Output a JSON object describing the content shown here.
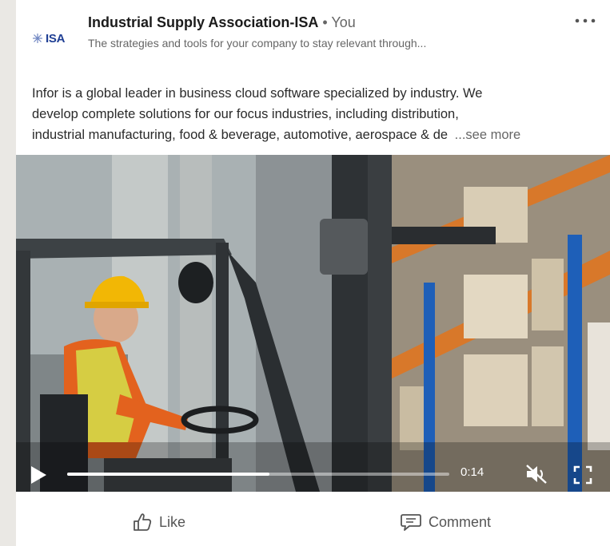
{
  "post": {
    "org_name": "Industrial Supply Association-ISA",
    "separator": " • ",
    "you_label": "You",
    "tagline": "The strategies and tools for your company to stay relevant through...",
    "logo_text": "ISA",
    "menu_icon": "more-horizontal-icon",
    "text_lines": [
      "Infor is a global leader in business cloud software specialized by industry. We",
      "develop complete solutions for our focus industries, including distribution,",
      "industrial manufacturing, food & beverage, automotive, aerospace & de"
    ],
    "see_more": "...see more"
  },
  "video": {
    "time": "0:14",
    "progress": 0.53,
    "muted": true,
    "icons": [
      "play-icon",
      "mute-icon",
      "fullscreen-icon"
    ]
  },
  "actions": {
    "like_label": "Like",
    "comment_label": "Comment"
  },
  "colors": {
    "brand_blue": "#1f3f94",
    "helmet_yellow": "#f2b705",
    "shelf_orange": "#d8782a",
    "rack_blue": "#1e5fb8"
  }
}
